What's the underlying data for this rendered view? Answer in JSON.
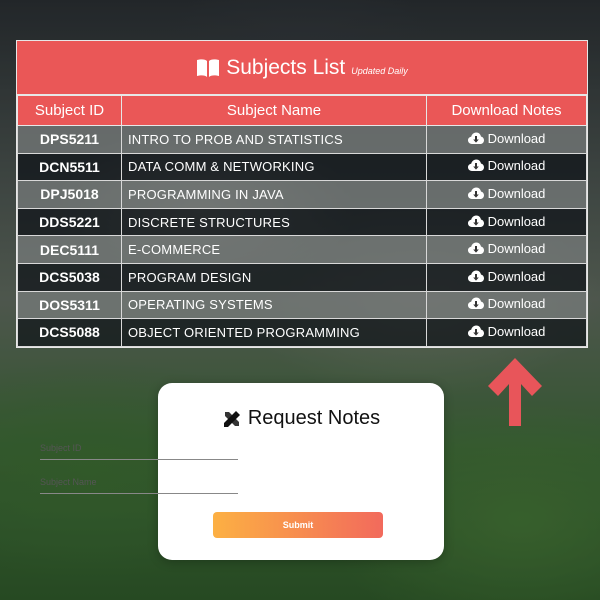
{
  "table": {
    "title": "Subjects List",
    "subtitle": "Updated Daily",
    "columns": [
      "Subject ID",
      "Subject Name",
      "Download Notes"
    ],
    "rows": [
      {
        "id": "DPS5211",
        "name": "Intro to Prob and Statistics",
        "action": "Download"
      },
      {
        "id": "DCN5511",
        "name": "Data Comm & Networking",
        "action": "Download"
      },
      {
        "id": "DPJ5018",
        "name": "Programming in Java",
        "action": "Download"
      },
      {
        "id": "DDS5221",
        "name": "Discrete Structures",
        "action": "Download"
      },
      {
        "id": "DEC5111",
        "name": "E-Commerce",
        "action": "Download"
      },
      {
        "id": "DCS5038",
        "name": "Program Design",
        "action": "Download"
      },
      {
        "id": "DOS5311",
        "name": "Operating Systems",
        "action": "Download"
      },
      {
        "id": "DCS5088",
        "name": "Object Oriented Programming",
        "action": "Download"
      }
    ],
    "header_color": "#ea5757"
  },
  "request": {
    "title": "Request Notes",
    "subject_id_placeholder": "Subject ID",
    "subject_name_placeholder": "Subject Name",
    "submit_label": "Submit",
    "submit_gradient": [
      "#fcb043",
      "#f26a5c"
    ]
  },
  "icons": {
    "title": "open-book-icon",
    "download": "cloud-download-icon",
    "request": "pencil-ruler-icon",
    "pointer": "arrow-up-icon"
  },
  "colors": {
    "arrow": "#e8555a",
    "card_bg": "#ffffff"
  }
}
